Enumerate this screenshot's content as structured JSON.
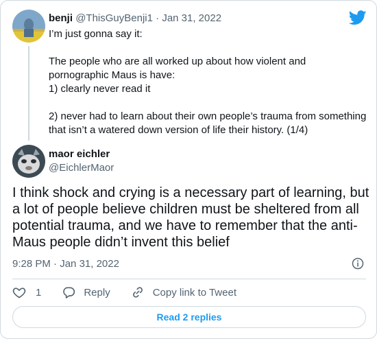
{
  "colors": {
    "accent": "#1d9bf0",
    "text": "#0f1419",
    "muted": "#536471",
    "border": "#cfd9de"
  },
  "parent_tweet": {
    "author_name": "benji",
    "author_handle": "@ThisGuyBenji1",
    "separator": "·",
    "date": "Jan 31, 2022",
    "text": "I’m just gonna say it:\n\nThe people who are all worked up about how violent and\npornographic Maus is have:\n1) clearly never read it\n\n2) never had to learn about their own people’s trauma from something\nthat isn’t a watered down version of life their history. (1/4)"
  },
  "reply_tweet": {
    "author_name": "maor eichler",
    "author_handle": "@EichlerMaor",
    "text": "I think shock and crying is a necessary part of learning, but a lot of people believe children must be sheltered from all potential trauma, and we have to remember that the anti-Maus people didn’t invent this belief",
    "time": "9:28 PM",
    "separator": "·",
    "date": "Jan 31, 2022"
  },
  "actions": {
    "like_count": "1",
    "reply_label": "Reply",
    "copy_link_label": "Copy link to Tweet"
  },
  "read_replies_label": "Read 2 replies",
  "icons": {
    "brand": "twitter-bird-icon",
    "info": "info-icon",
    "like": "heart-icon",
    "reply": "comment-bubble-icon",
    "link": "link-icon"
  }
}
